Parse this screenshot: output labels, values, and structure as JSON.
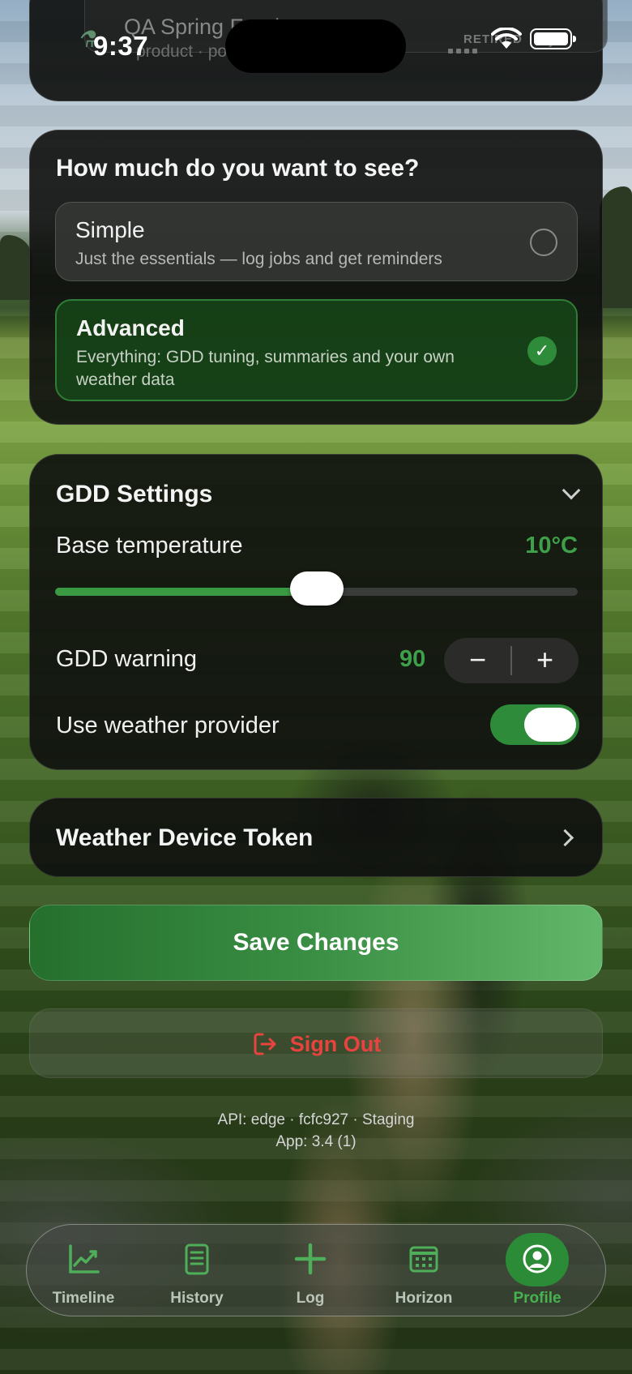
{
  "status_bar": {
    "time": "9:37"
  },
  "top_card": {
    "title": "QA Spring Feed",
    "subtitle": "product · po",
    "badge": "RETIRED"
  },
  "view_mode": {
    "title": "How much do you want to see?",
    "options": [
      {
        "label": "Simple",
        "description": "Just the essentials — log jobs and get reminders",
        "selected": false
      },
      {
        "label": "Advanced",
        "description": "Everything: GDD tuning, summaries and your own weather data",
        "selected": true
      }
    ]
  },
  "gdd_settings": {
    "title": "GDD Settings",
    "base_temperature_label": "Base temperature",
    "base_temperature_value": "10°C",
    "base_temperature_slider_fraction": 0.5,
    "gdd_warning_label": "GDD warning",
    "gdd_warning_value": "90",
    "decrement_label": "−",
    "increment_label": "+",
    "weather_provider_label": "Use weather provider",
    "weather_provider_enabled": true
  },
  "weather_token": {
    "label": "Weather Device Token"
  },
  "actions": {
    "save_label": "Save Changes",
    "signout_label": "Sign Out"
  },
  "footer": {
    "api_info": "API: edge · fcfc927 · Staging",
    "app_info": "App: 3.4 (1)"
  },
  "tabs": [
    {
      "label": "Timeline",
      "icon": "chart-line-icon",
      "active": false
    },
    {
      "label": "History",
      "icon": "clipboard-list-icon",
      "active": false
    },
    {
      "label": "Log",
      "icon": "plus-icon",
      "active": false
    },
    {
      "label": "Horizon",
      "icon": "calendar-icon",
      "active": false
    },
    {
      "label": "Profile",
      "icon": "user-circle-icon",
      "active": true
    }
  ],
  "colors": {
    "accent_green": "#2e8b3a",
    "value_green": "#3ea14a",
    "signout_red": "#e8433f"
  }
}
